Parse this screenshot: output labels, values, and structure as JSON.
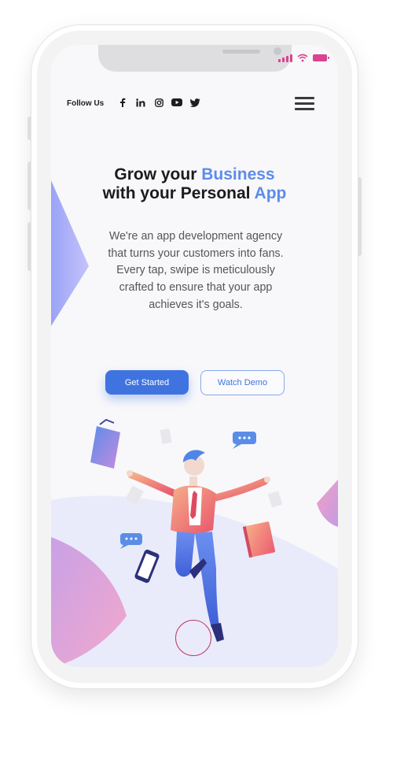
{
  "header": {
    "follow_label": "Follow Us",
    "social_icons": [
      "facebook-icon",
      "linkedin-icon",
      "instagram-icon",
      "youtube-icon",
      "twitter-icon"
    ]
  },
  "hero": {
    "title_line1_plain": "Grow your ",
    "title_line1_highlight": "Business",
    "title_line2_plain": "with your Personal ",
    "title_line2_highlight": "App",
    "description": "We're an app development agency that turns your customers into fans. Every tap, swipe is meticulously crafted to ensure that your app achieves it's goals.",
    "primary_button": "Get Started",
    "secondary_button": "Watch Demo"
  },
  "colors": {
    "accent": "#3f74e0",
    "highlight": "#5e8bea",
    "status": "#d9438f"
  }
}
